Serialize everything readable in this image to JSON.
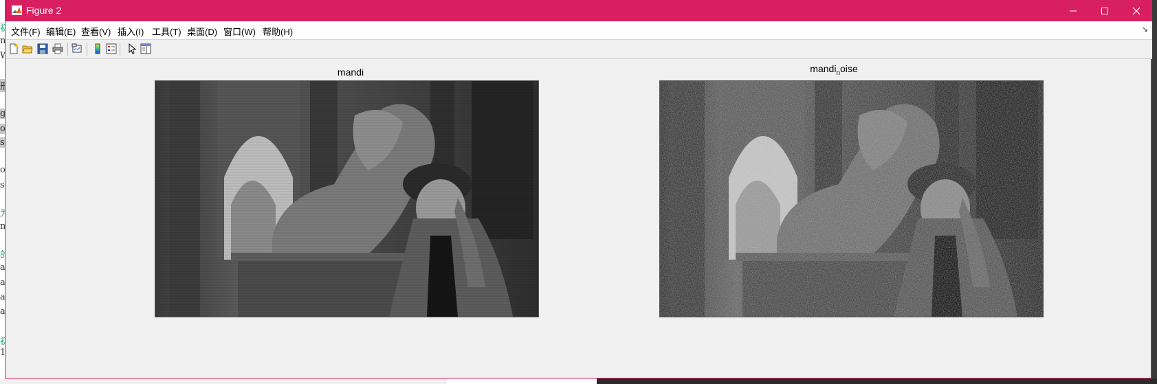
{
  "window": {
    "title": "Figure 2",
    "accent_color": "#d81f60",
    "icon": "matlab-logo-icon"
  },
  "menu": [
    "文件(F)",
    "编辑(E)",
    "查看(V)",
    "插入(I)",
    "工具(T)",
    "桌面(D)",
    "窗口(W)",
    "帮助(H)"
  ],
  "toolbar": {
    "buttons": [
      "new-figure-icon",
      "open-file-icon",
      "save-icon",
      "print-icon",
      "link-plot-icon",
      "colorbar-icon",
      "legend-icon",
      "select-pointer-icon",
      "property-editor-icon"
    ]
  },
  "subplots": [
    {
      "title_main": "mandi",
      "title_sub": "",
      "title_rest": "",
      "image": "grayscale photo: woman in cap beside stone lion statue"
    },
    {
      "title_main": "mandi",
      "title_sub": "n",
      "title_rest": "oise",
      "image": "same grayscale photo with salt-and-pepper noise"
    }
  ]
}
